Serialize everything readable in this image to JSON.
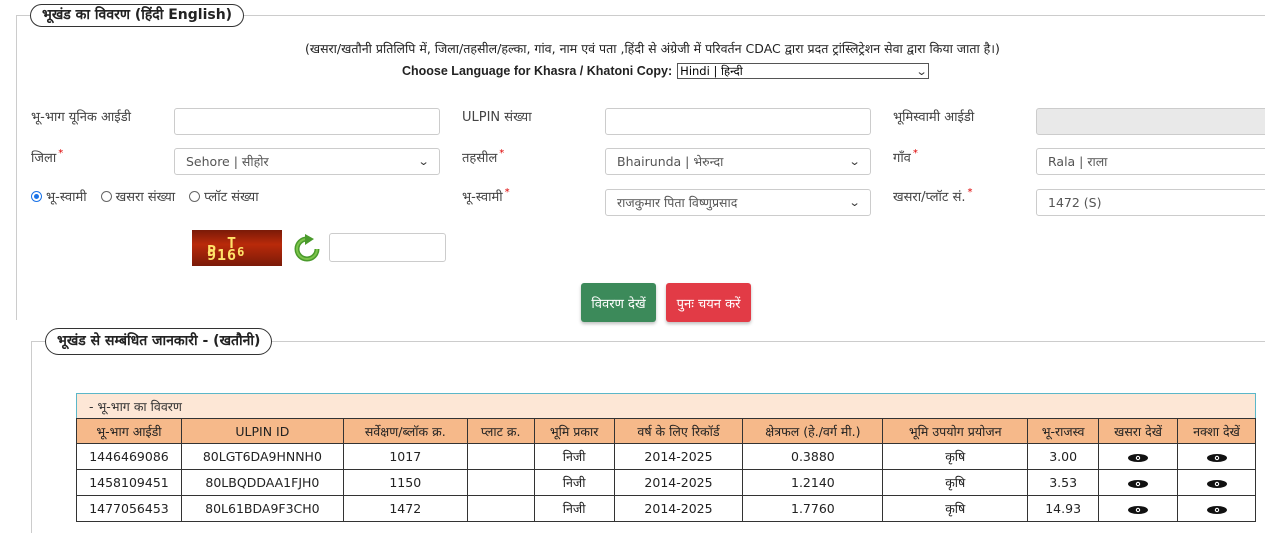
{
  "section1": {
    "legend": "भूखंड का विवरण  (हिंदी  English)",
    "note": "(खसरा/खतौनी प्रतिलिपि में, जिला/तहसील/हल्का, गांव, नाम एवं पता ,हिंदी से अंग्रेजी में परिवर्तन CDAC द्वारा प्रदत ट्रांस्लिट्रेशन सेवा द्वारा किया जाता है।)",
    "language_label": "Choose Language for Khasra / Khatoni Copy:",
    "language_value": "Hindi | हिन्दी"
  },
  "form": {
    "unique_id_label": "भू-भाग यूनिक आईडी",
    "unique_id_value": "",
    "ulpin_label": "ULPIN संख्या",
    "ulpin_value": "",
    "owner_id_label": "भूमिस्वामी आईडी",
    "owner_id_value": "",
    "district_label": "जिला",
    "district_value": "Sehore | सीहोर",
    "tehsil_label": "तहसील",
    "tehsil_value": "Bhairunda | भेरुन्दा",
    "village_label": "गाँव",
    "village_value": "Rala | राला",
    "radio_owner": "भू-स्वामी",
    "radio_khasra": "खसरा संख्या",
    "radio_plot": "प्लॉट संख्या",
    "owner_label": "भू-स्वामी",
    "owner_value": "राजकुमार पिता विष्णुप्रसाद",
    "khasra_label": "खसरा/प्लॉट सं.",
    "khasra_value": "1472 (S)",
    "required_mark": "*",
    "captcha_text": "PT6916",
    "captcha_input": ""
  },
  "buttons": {
    "view": "विवरण देखें",
    "reset": "पुनः चयन करें"
  },
  "section2": {
    "legend": "भूखंड से सम्बंधित जानकारी -   (खतौनी)",
    "table_caption": "- भू-भाग का विवरण"
  },
  "table": {
    "headers": [
      "भू-भाग आईडी",
      "ULPIN ID",
      "सर्वेक्षण/ब्लॉक क्र.",
      "प्लाट क्र.",
      "भूमि प्रकार",
      "वर्ष के लिए रिकॉर्ड",
      "क्षेत्रफल (हे./वर्ग मी.)",
      "भूमि उपयोग प्रयोजन",
      "भू-राजस्व",
      "खसरा देखें",
      "नक्शा देखें"
    ],
    "rows": [
      [
        "1446469086",
        "80LGT6DA9HNNH0",
        "1017",
        "",
        "निजी",
        "2014-2025",
        "0.3880",
        "कृषि",
        "3.00"
      ],
      [
        "1458109451",
        "80LBQDDAA1FJH0",
        "1150",
        "",
        "निजी",
        "2014-2025",
        "1.2140",
        "कृषि",
        "3.53"
      ],
      [
        "1477056453",
        "80L61BDA9F3CH0",
        "1472",
        "",
        "निजी",
        "2014-2025",
        "1.7760",
        "कृषि",
        "14.93"
      ]
    ]
  },
  "icons": {
    "view_khasra": "eye-icon",
    "view_map": "eye-icon",
    "refresh": "refresh-icon",
    "dropdown": "chevron-down-icon"
  },
  "colors": {
    "header_bg": "#f6b98a",
    "caption_bg": "#fde7d6",
    "view_button": "#3c8a5a",
    "reset_button": "#e23b46",
    "required": "#dd0000"
  }
}
